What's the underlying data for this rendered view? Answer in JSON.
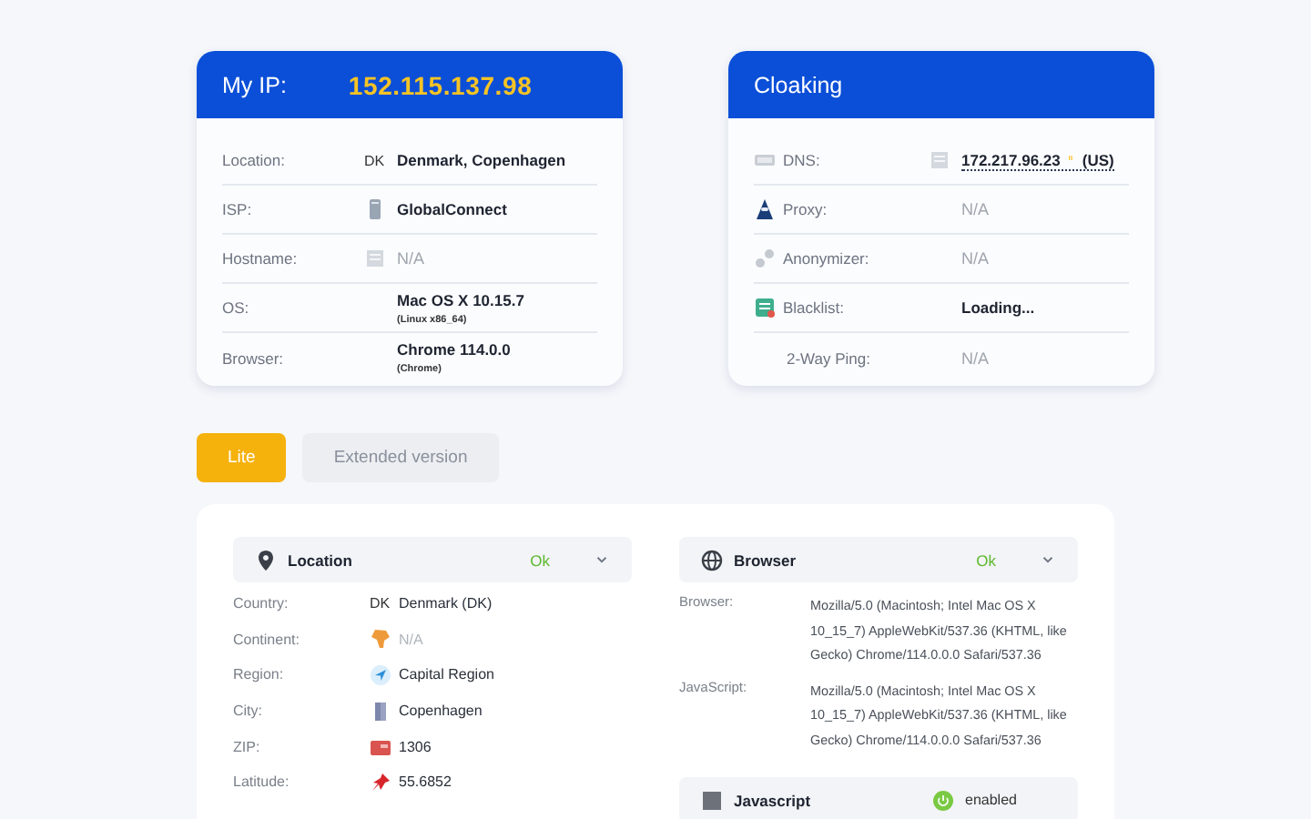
{
  "my_ip": {
    "label": "My IP:",
    "ip": "152.115.137.98",
    "rows": [
      {
        "label": "Location:",
        "code": "DK",
        "value": "Denmark, Copenhagen",
        "muted": false
      },
      {
        "label": "ISP:",
        "value": "GlobalConnect",
        "muted": false
      },
      {
        "label": "Hostname:",
        "value": "N/A",
        "muted": true
      },
      {
        "label": "OS:",
        "value": "Mac OS X 10.15.7",
        "detail": "(Linux x86_64)",
        "muted": false
      },
      {
        "label": "Browser:",
        "value": "Chrome 114.0.0",
        "detail": "(Chrome)",
        "muted": false
      }
    ]
  },
  "cloaking": {
    "title": "Cloaking",
    "rows": [
      {
        "label": "DNS:",
        "value": "172.217.96.23",
        "suffix": "(US)",
        "muted": false
      },
      {
        "label": "Proxy:",
        "value": "N/A",
        "muted": true
      },
      {
        "label": "Anonymizer:",
        "value": "N/A",
        "muted": true
      },
      {
        "label": "Blacklist:",
        "value": "Loading...",
        "muted": false
      },
      {
        "label": "2-Way Ping:",
        "value": "N/A",
        "muted": true
      }
    ]
  },
  "tabs": [
    {
      "label": "Lite",
      "selected": true
    },
    {
      "label": "Extended version",
      "selected": false
    }
  ],
  "location": {
    "title": "Location",
    "status": "Ok",
    "rows": [
      {
        "label": "Country:",
        "code": "DK",
        "value": "Denmark (DK)",
        "muted": false
      },
      {
        "label": "Continent:",
        "value": "N/A",
        "muted": true
      },
      {
        "label": "Region:",
        "value": "Capital Region",
        "muted": false
      },
      {
        "label": "City:",
        "value": "Copenhagen",
        "muted": false
      },
      {
        "label": "ZIP:",
        "value": "1306",
        "muted": false
      },
      {
        "label": "Latitude:",
        "value": "55.6852",
        "muted": false
      }
    ]
  },
  "browser": {
    "title": "Browser",
    "status": "Ok",
    "rows": [
      {
        "label": "Browser:",
        "value": "Mozilla/5.0 (Macintosh; Intel Mac OS X 10_15_7) AppleWebKit/537.36 (KHTML, like Gecko) Chrome/114.0.0.0 Safari/537.36"
      },
      {
        "label": "JavaScript:",
        "value": "Mozilla/5.0 (Macintosh; Intel Mac OS X 10_15_7) AppleWebKit/537.36 (KHTML, like Gecko) Chrome/114.0.0.0 Safari/537.36"
      }
    ]
  },
  "javascript": {
    "title": "Javascript",
    "status": "enabled",
    "on": true
  }
}
